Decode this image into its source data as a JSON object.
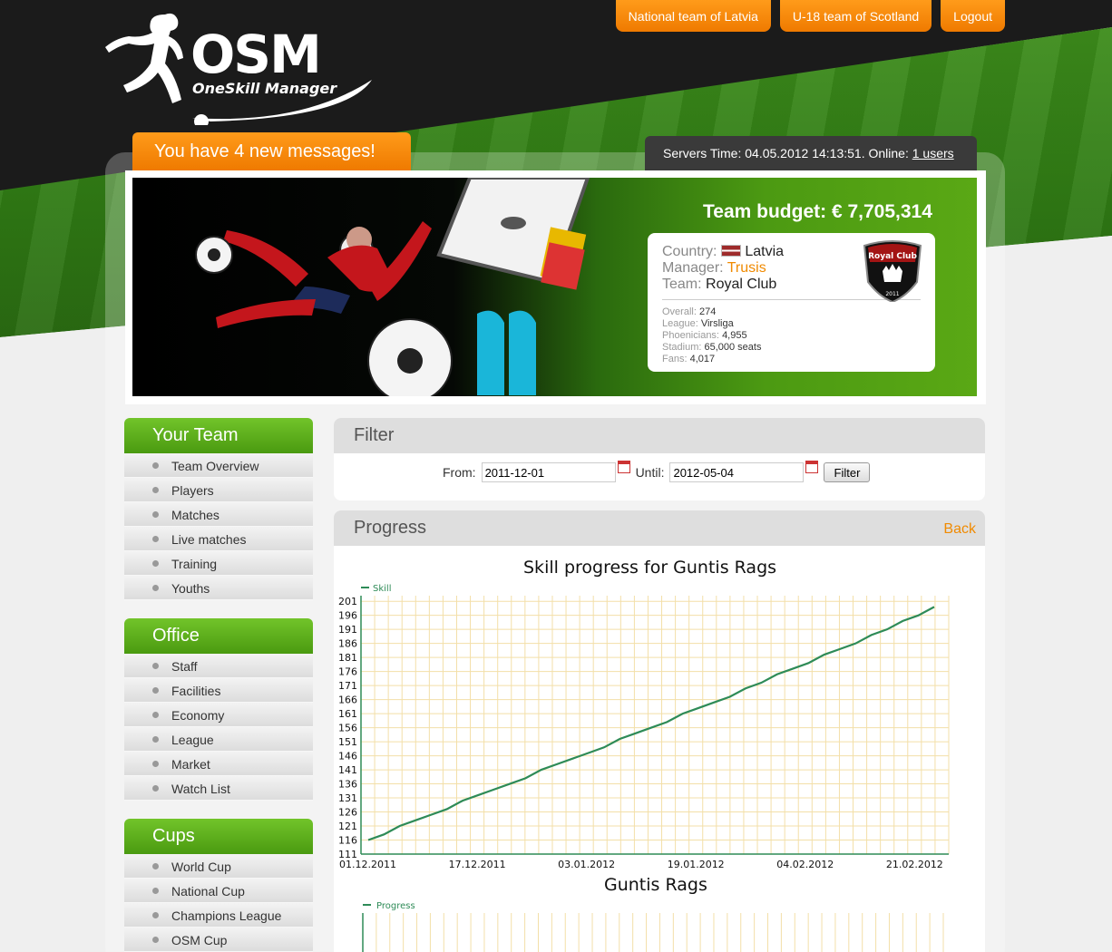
{
  "logo": {
    "title": "OSM",
    "subtitle": "OneSkill Manager"
  },
  "topnav": [
    "National team of Latvia",
    "U-18 team of Scotland",
    "Logout"
  ],
  "messages": "You have 4 new messages!",
  "server": {
    "prefix": "Servers Time: 04.05.2012 14:13:51. Online: ",
    "users_link": "1 users"
  },
  "team": {
    "budget": "Team budget: € 7,705,314",
    "country_label": "Country:",
    "country": "Latvia",
    "manager_label": "Manager:",
    "manager": "Trusis",
    "team_label": "Team:",
    "team": "Royal Club",
    "crest_name": "Royal Club",
    "crest_year": "2011",
    "stats": [
      {
        "label": "Overall:",
        "value": "274"
      },
      {
        "label": "League:",
        "value": "Virsliga"
      },
      {
        "label": "Phoenicians:",
        "value": "4,955"
      },
      {
        "label": "Stadium:",
        "value": "65,000 seats"
      },
      {
        "label": "Fans:",
        "value": "4,017"
      }
    ]
  },
  "sidebar": {
    "your_team": {
      "title": "Your Team",
      "items": [
        "Team Overview",
        "Players",
        "Matches",
        "Live matches",
        "Training",
        "Youths"
      ]
    },
    "office": {
      "title": "Office",
      "items": [
        "Staff",
        "Facilities",
        "Economy",
        "League",
        "Market",
        "Watch List"
      ]
    },
    "cups": {
      "title": "Cups",
      "items": [
        "World Cup",
        "National Cup",
        "Champions League",
        "OSM Cup"
      ]
    }
  },
  "filter": {
    "title": "Filter",
    "from_label": "From:",
    "from_value": "2011-12-01",
    "until_label": "Until:",
    "until_value": "2012-05-04",
    "button": "Filter"
  },
  "progress": {
    "title": "Progress",
    "back": "Back"
  },
  "chart_data": [
    {
      "type": "line",
      "title": "Skill progress for Guntis Rags",
      "series": [
        {
          "name": "Skill",
          "color": "#2e8b57",
          "values": [
            116,
            118,
            121,
            123,
            125,
            127,
            130,
            132,
            134,
            136,
            138,
            141,
            143,
            145,
            147,
            149,
            152,
            154,
            156,
            158,
            161,
            163,
            165,
            167,
            170,
            172,
            175,
            177,
            179,
            182,
            184,
            186,
            189,
            191,
            194,
            196,
            199
          ]
        }
      ],
      "yticks": [
        111,
        116,
        121,
        126,
        131,
        136,
        141,
        146,
        151,
        156,
        161,
        166,
        171,
        176,
        181,
        186,
        191,
        196,
        201
      ],
      "ylim": [
        111,
        203
      ],
      "xtick_labels": [
        "01.12.2011",
        "17.12.2011",
        "03.01.2012",
        "19.01.2012",
        "04.02.2012",
        "21.02.2012"
      ],
      "xtick_index": [
        1,
        9,
        17,
        25,
        33,
        41
      ],
      "n_points": 37,
      "grid": true,
      "legend": "top-left"
    },
    {
      "type": "bar",
      "title": "Guntis Rags",
      "series": [
        {
          "name": "Progress",
          "color": "#2e8b57"
        }
      ],
      "grid": true,
      "legend": "top-left"
    }
  ]
}
